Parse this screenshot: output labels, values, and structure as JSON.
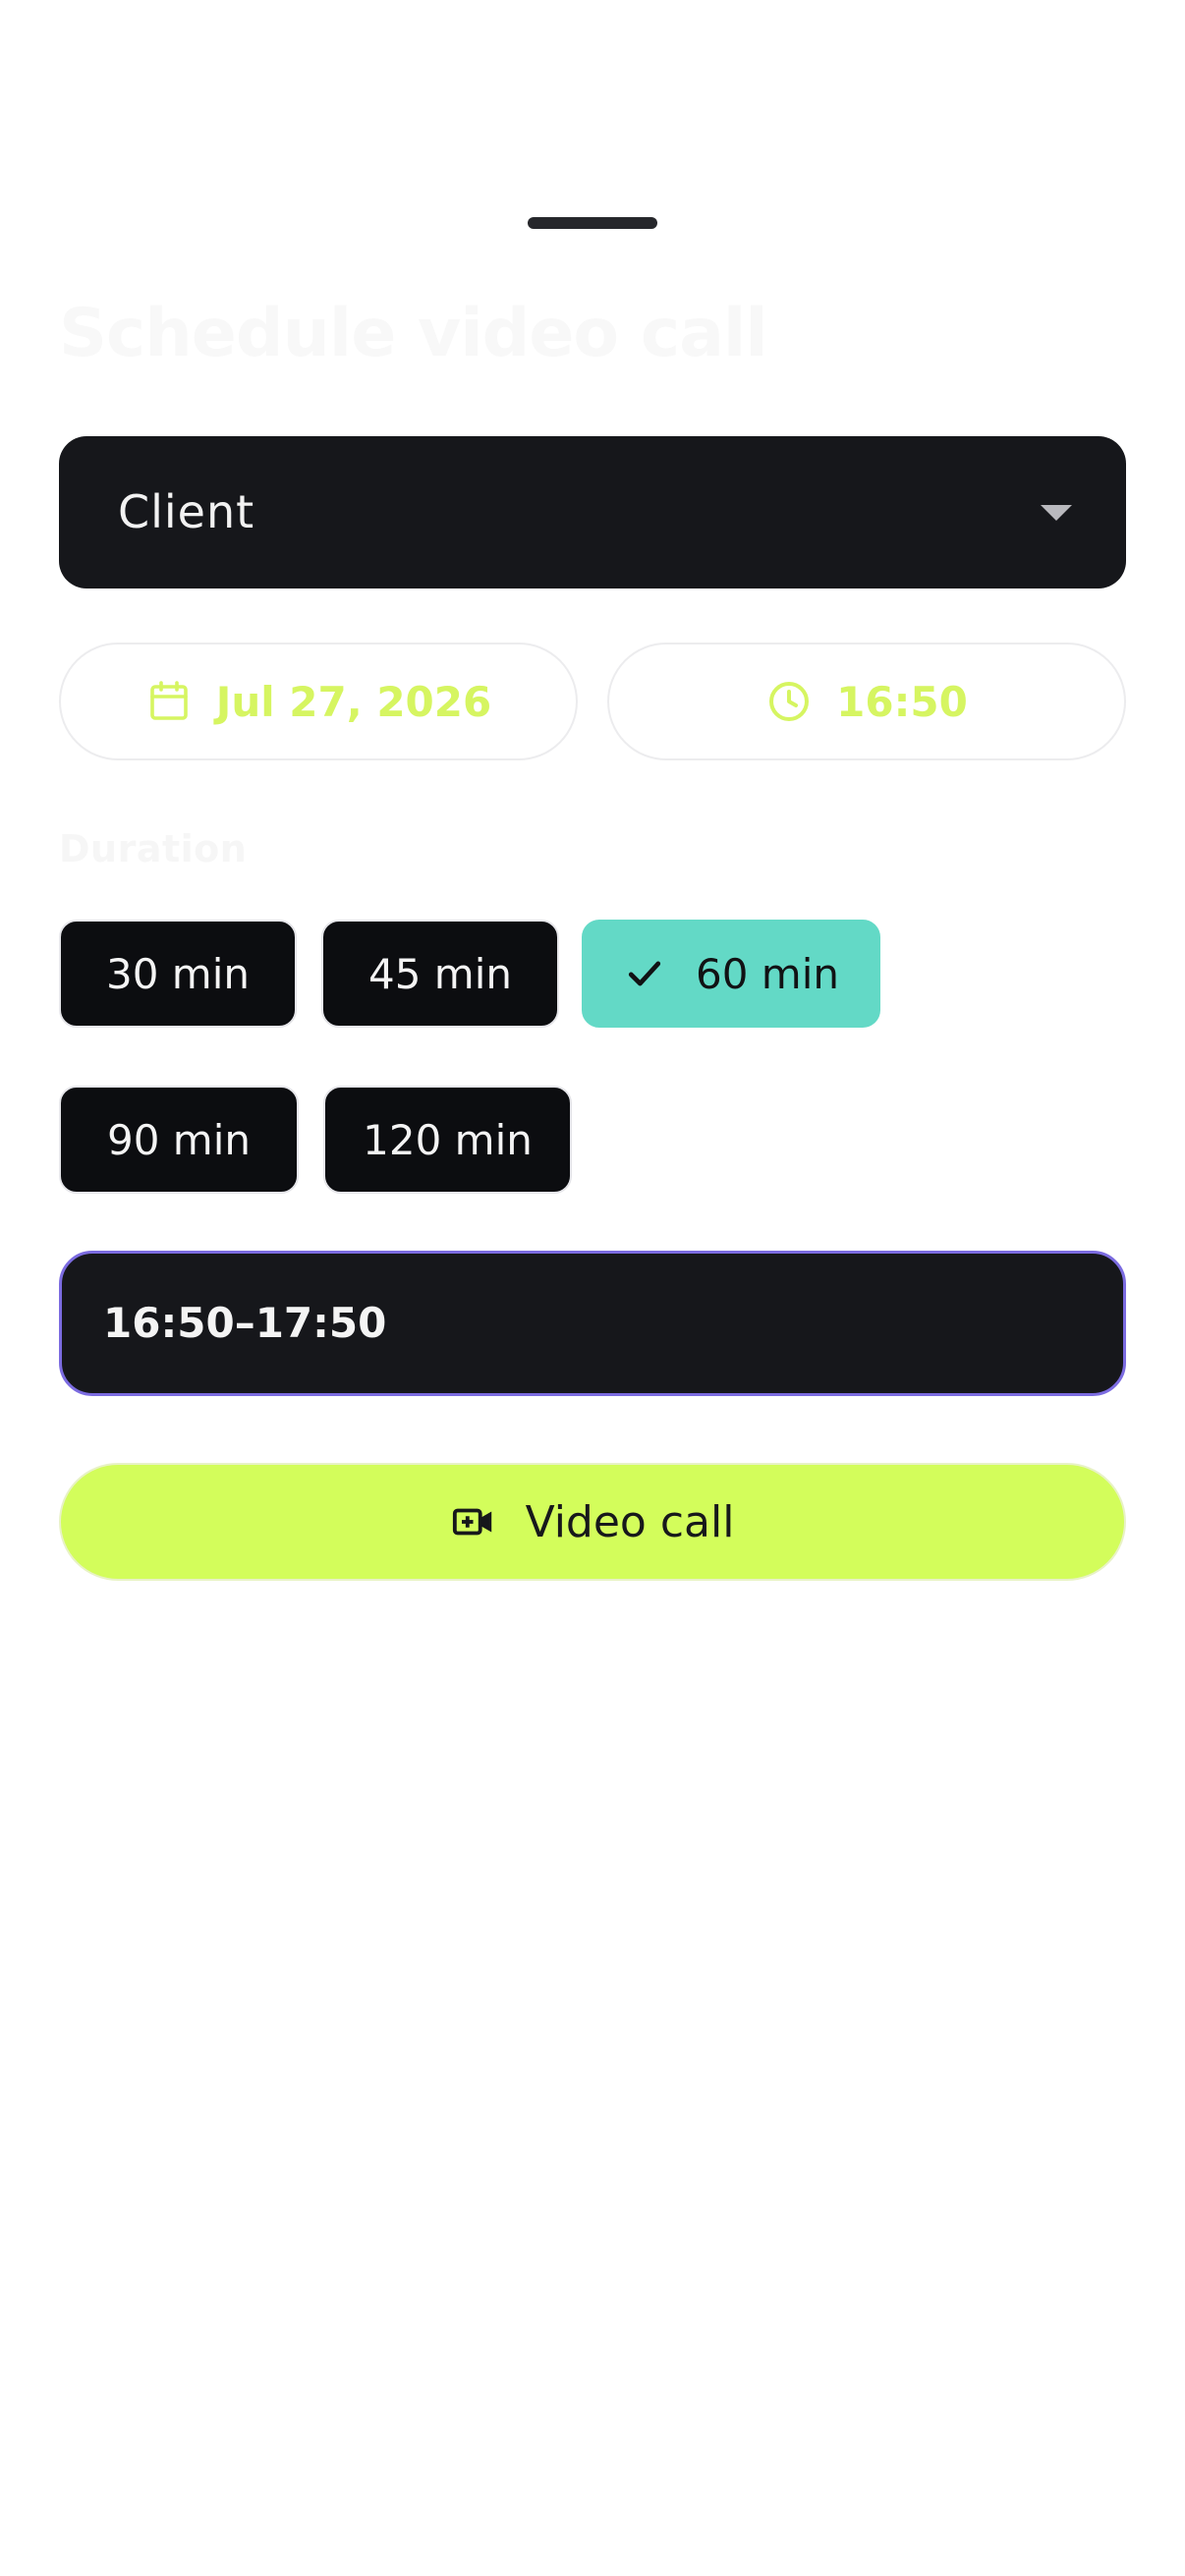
{
  "sheet": {
    "title": "Schedule video call",
    "contact_select": {
      "value": "Client"
    },
    "date_button": {
      "label": "Jul 27, 2026",
      "icon": "calendar-icon"
    },
    "time_button": {
      "label": "16:50",
      "icon": "clock-icon"
    },
    "duration": {
      "label": "Duration",
      "options": [
        {
          "label": "30 min",
          "selected": false
        },
        {
          "label": "45 min",
          "selected": false
        },
        {
          "label": "60 min",
          "selected": true
        },
        {
          "label": "90 min",
          "selected": false
        },
        {
          "label": "120 min",
          "selected": false
        }
      ]
    },
    "time_range": {
      "value": "16:50–17:50"
    },
    "video_call_button": {
      "label": "Video call",
      "icon": "video-add-icon"
    }
  },
  "colors": {
    "accent_lime": "#d3fd5b",
    "accent_teal": "#63d9c6",
    "dark_surface": "#16171b",
    "focus_border": "#7b6be0"
  }
}
